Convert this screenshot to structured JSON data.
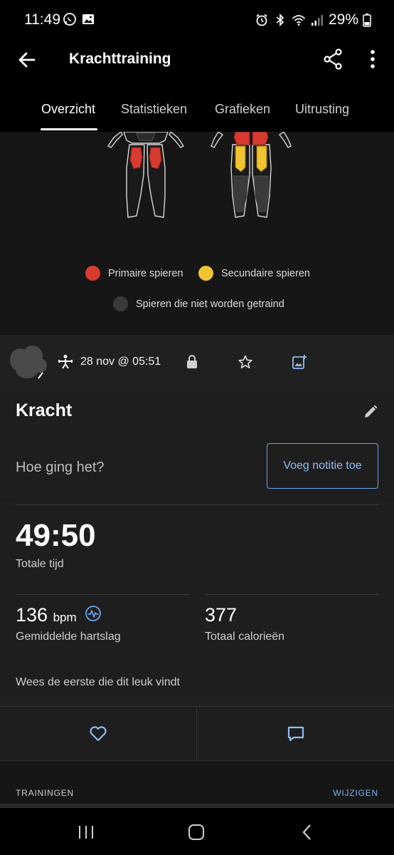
{
  "status_bar": {
    "time": "11:49",
    "battery": "29%",
    "left_icons": [
      "whatsapp-icon",
      "gallery-icon"
    ],
    "right_icons": [
      "alarm-icon",
      "bluetooth-icon",
      "wifi-icon",
      "signal-icon",
      "battery-icon"
    ]
  },
  "app_bar": {
    "title": "Krachttraining",
    "back_icon": "arrow-left-icon",
    "share_icon": "share-icon",
    "more_icon": "more-vert-icon"
  },
  "tabs": [
    {
      "label": "Overzicht",
      "active": true
    },
    {
      "label": "Statistieken",
      "active": false
    },
    {
      "label": "Grafieken",
      "active": false
    },
    {
      "label": "Uitrusting",
      "active": false
    }
  ],
  "muscle_map": {
    "colors": {
      "primary": "#d93a30",
      "secondary": "#f0c330",
      "untrained": "#3a3a3a"
    },
    "legend": {
      "primary": "Primaire spieren",
      "secondary": "Secundaire spieren",
      "untrained": "Spieren die niet worden getraind"
    }
  },
  "activity": {
    "date": "28 nov @ 05:51",
    "icons": [
      "strength-person-icon",
      "lock-icon",
      "star-outline-icon",
      "add-photo-icon"
    ],
    "title": "Kracht",
    "note_prompt": "Hoe ging het?",
    "note_button": "Voeg notitie toe",
    "total_time": "49:50",
    "total_time_label": "Totale tijd",
    "heart_rate": {
      "value": "136",
      "unit": "bpm",
      "label": "Gemiddelde hartslag"
    },
    "calories": {
      "value": "377",
      "label": "Totaal calorieën"
    },
    "likes_text": "Wees de eerste die dit leuk vindt",
    "accent_color": "#6aa4e8"
  },
  "trainingen": {
    "label": "TRAININGEN",
    "action": "WIJZIGEN"
  },
  "nav": [
    "recents-icon",
    "home-icon",
    "back-icon"
  ]
}
